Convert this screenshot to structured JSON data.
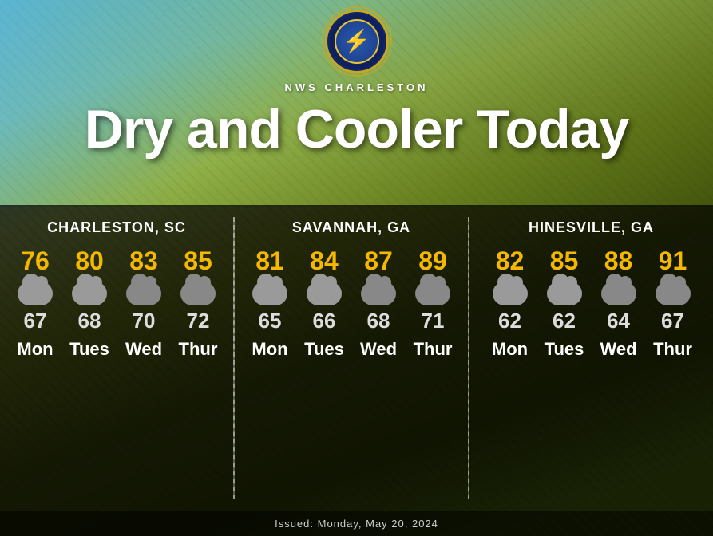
{
  "header": {
    "service_name": "NWS CHARLESTON",
    "title": "Dry and Cooler Today"
  },
  "issued": "Issued: Monday, May 20, 2024",
  "cities": [
    {
      "name": "CHARLESTON, SC",
      "days": [
        {
          "day": "Mon",
          "high": "76",
          "low": "67"
        },
        {
          "day": "Tues",
          "high": "80",
          "low": "68"
        },
        {
          "day": "Wed",
          "high": "83",
          "low": "70"
        },
        {
          "day": "Thur",
          "high": "85",
          "low": "72"
        }
      ]
    },
    {
      "name": "SAVANNAH, GA",
      "days": [
        {
          "day": "Mon",
          "high": "81",
          "low": "65"
        },
        {
          "day": "Tues",
          "high": "84",
          "low": "66"
        },
        {
          "day": "Wed",
          "high": "87",
          "low": "68"
        },
        {
          "day": "Thur",
          "high": "89",
          "low": "71"
        }
      ]
    },
    {
      "name": "HINESVILLE, GA",
      "days": [
        {
          "day": "Mon",
          "high": "82",
          "low": "62"
        },
        {
          "day": "Tues",
          "high": "85",
          "low": "62"
        },
        {
          "day": "Wed",
          "high": "88",
          "low": "64"
        },
        {
          "day": "Thur",
          "high": "91",
          "low": "67"
        }
      ]
    }
  ]
}
